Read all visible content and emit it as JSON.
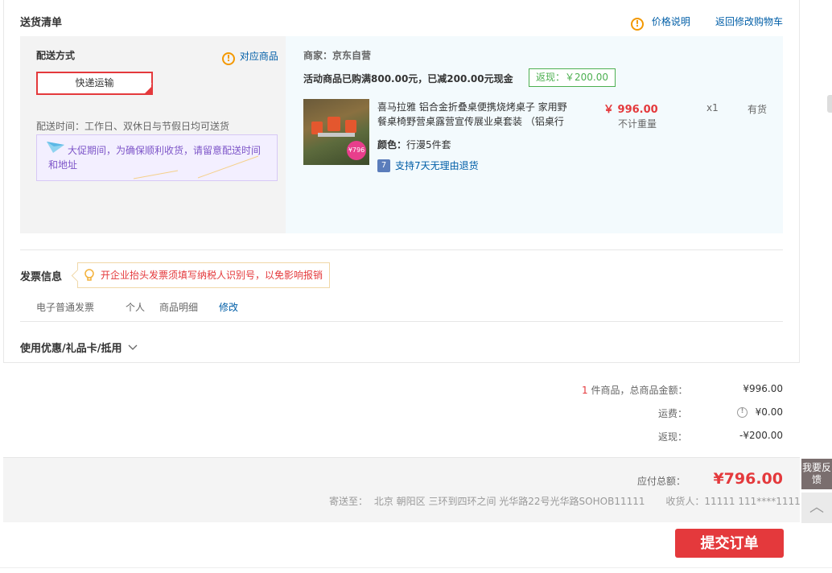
{
  "delivery": {
    "section_title": "送货清单",
    "price_note": "价格说明",
    "back_to_cart": "返回修改购物车",
    "method_label": "配送方式",
    "matching_items": "对应商品",
    "shipping_option": "快递运输",
    "delivery_time": "配送时间：工作日、双休日与节假日均可送货",
    "promo_notice": "大促期间，为确保顺利收货，请留意配送时间和地址"
  },
  "merchant": {
    "seller": "商家：京东自营",
    "promotion_text": "活动商品已购满800.00元，已减200.00元现金",
    "rebate_tag": "返现：￥200.00"
  },
  "product": {
    "title": "喜马拉雅 铝合金折叠桌便携烧烤桌子 家用野餐桌椅野营桌露营宣传展业桌套装 （铝桌行",
    "price": "￥ 996.00",
    "weight_note": "不计重量",
    "quantity": "x1",
    "stock": "有货",
    "color_label": "颜色：",
    "color_value": "行漫5件套",
    "return_policy": "支持7天无理由退货",
    "image_badge": "¥796"
  },
  "invoice": {
    "title": "发票信息",
    "tip": "开企业抬头发票须填写纳税人识别号，以免影响报销",
    "type": "电子普通发票",
    "holder": "个人",
    "content": "商品明细",
    "modify": "修改"
  },
  "coupon": {
    "label": "使用优惠/礼品卡/抵用"
  },
  "summary": {
    "count": "1",
    "count_text": "件商品，总商品金额：",
    "goods_amount": "¥996.00",
    "shipping_label": "运费：",
    "shipping_amount": "¥0.00",
    "rebate_label": "返现：",
    "rebate_amount": "-¥200.00"
  },
  "total": {
    "label": "应付总额：",
    "amount": "¥796.00",
    "ship_to_label": "寄送至：",
    "address": "北京 朝阳区 三环到四环之间 光华路22号光华路SOHOB11111",
    "receiver": "收货人：11111 111****1111"
  },
  "submit_label": "提交订单",
  "sidebar": {
    "feedback": "我要反馈",
    "back_to_top": "︿"
  },
  "colors": {
    "accent_red": "#e4393c",
    "link_blue": "#005ea7",
    "warning_orange": "#f39800",
    "promo_purple": "#7d55c8",
    "rebate_green": "#4caf50"
  }
}
